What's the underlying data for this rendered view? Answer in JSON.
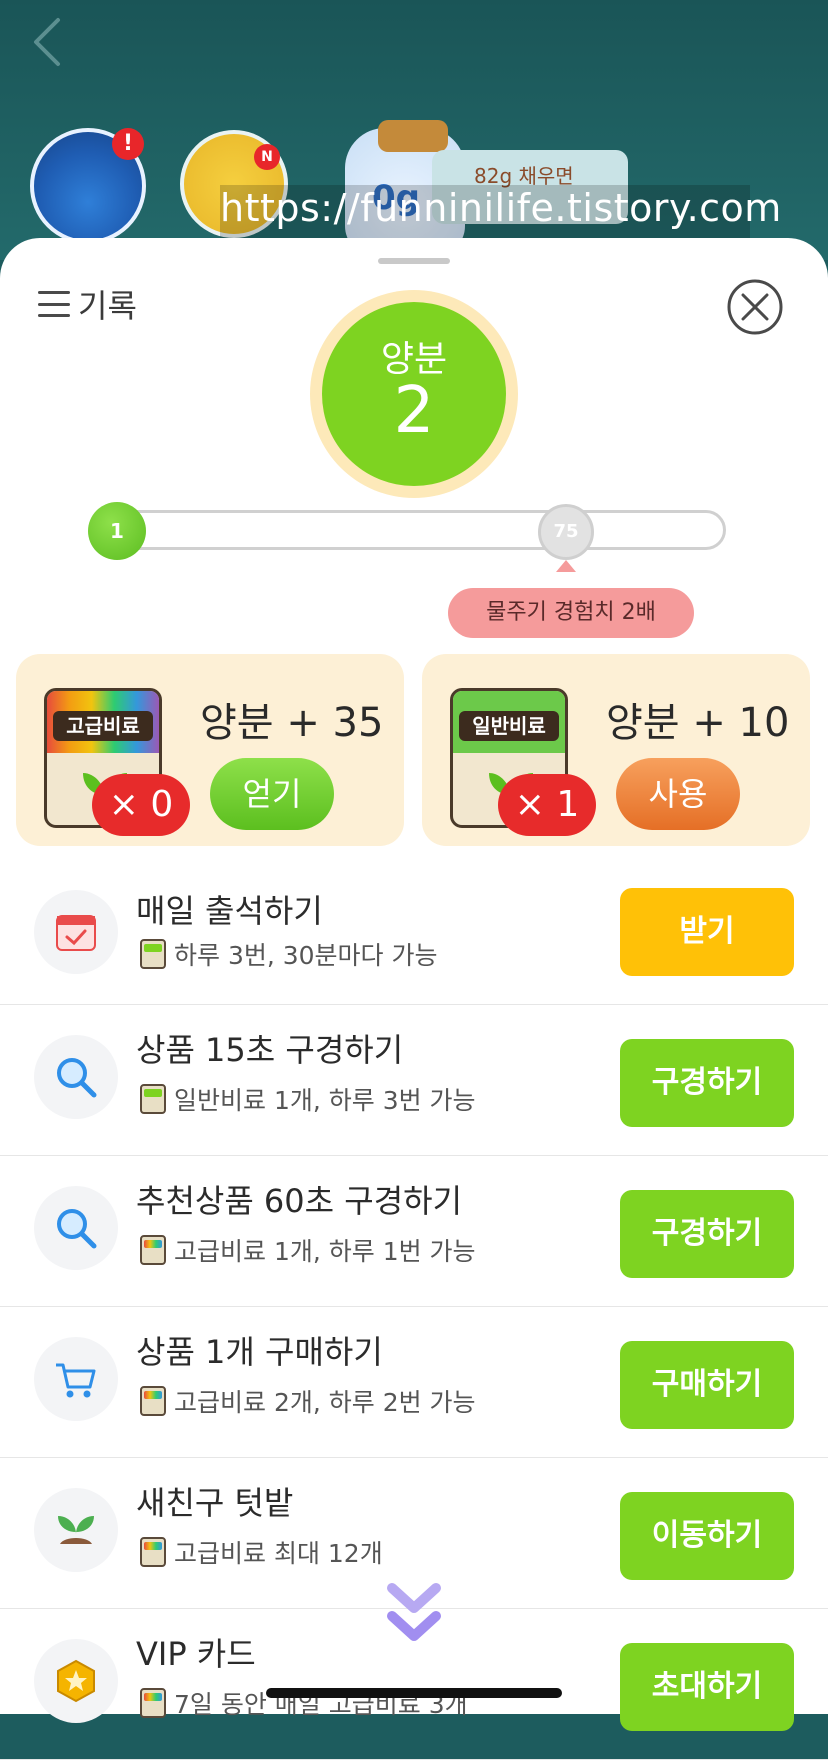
{
  "scene": {
    "back_icon": "chevron-left-icon",
    "potion_badge": "!",
    "sprout_badge": "N",
    "jar_label": "0g",
    "jar_bubble": "82g 채우면",
    "watermark": "https://funninilife.tistory.com"
  },
  "header": {
    "record_label": "기록",
    "close_icon": "close-circle-icon"
  },
  "level": {
    "label": "양분",
    "value": "2"
  },
  "progress": {
    "start": "1",
    "end": "75",
    "tooltip": "물주기 경험치 2배"
  },
  "fertilizers": [
    {
      "bag_label": "고급비료",
      "count": "× 0",
      "amount": "양분 + 35",
      "button": "얻기"
    },
    {
      "bag_label": "일반비료",
      "count": "× 1",
      "amount": "양분 + 10",
      "button": "사용"
    }
  ],
  "tasks": [
    {
      "icon": "calendar-icon",
      "title": "매일 출석하기",
      "sub": "하루 3번, 30분마다 가능",
      "button": "받기"
    },
    {
      "icon": "search-icon",
      "title": "상품 15초 구경하기",
      "sub": "일반비료 1개, 하루 3번 가능",
      "button": "구경하기"
    },
    {
      "icon": "search-icon",
      "title": "추천상품 60초 구경하기",
      "sub": "고급비료 1개, 하루 1번 가능",
      "button": "구경하기"
    },
    {
      "icon": "cart-icon",
      "title": "상품 1개 구매하기",
      "sub": "고급비료 2개, 하루 2번 가능",
      "button": "구매하기"
    },
    {
      "icon": "sprout-icon",
      "title": "새친구 텃밭",
      "sub": "고급비료 최대 12개",
      "button": "이동하기"
    },
    {
      "icon": "star-badge-icon",
      "title": "VIP 카드",
      "sub": "7일 동안 매일 고급비료 3개",
      "button": "초대하기"
    }
  ],
  "colors": {
    "accent_green": "#7ed321",
    "accent_yellow": "#ffc107",
    "use_orange": "#e56f26",
    "count_red": "#e72b2b",
    "card_bg": "#fdf0d6"
  }
}
